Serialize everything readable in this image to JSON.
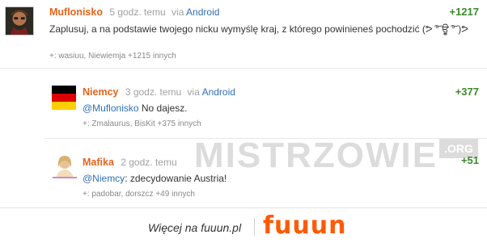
{
  "comments": [
    {
      "author": "Muflonisko",
      "time": "5 godz. temu",
      "via_prefix": "via",
      "via_app": "Android",
      "score": "+1217",
      "text": "Zaplusuj, a na podstawie twojego nicku wymyślę kraj, z którego powinieneś pochodzić (ᕗ ͠° ਊ ͠° )ᕗ",
      "votes": "+: wasiuu, Niewiemja +1215 innych",
      "avatar": "avatar-icon"
    },
    {
      "author": "Niemcy",
      "time": "3 godz. temu",
      "via_prefix": "via",
      "via_app": "Android",
      "score": "+377",
      "mention": "@Muflonisko",
      "text_rest": " No dajesz.",
      "votes": "+: Zmalaurus, BisKit +375 innych",
      "avatar": "german-flag-icon"
    },
    {
      "author": "Mafika",
      "time": "2 godz. temu",
      "score": "+51",
      "mention": "@Niemcy",
      "text_rest": ": zdecydowanie Austria!",
      "votes": "+: padobar, dorszcz +49 innych",
      "avatar": "female-avatar-icon"
    }
  ],
  "watermark": {
    "main": "MISTRZOWIE",
    "suffix": ".ORG"
  },
  "footer": {
    "more_text": "Więcej na fuuun.pl",
    "brand": "fuuun"
  },
  "colors": {
    "author": "#e5631d",
    "score": "#3a8a2a",
    "link": "#2f6fb8",
    "brand": "#ff5a00"
  }
}
